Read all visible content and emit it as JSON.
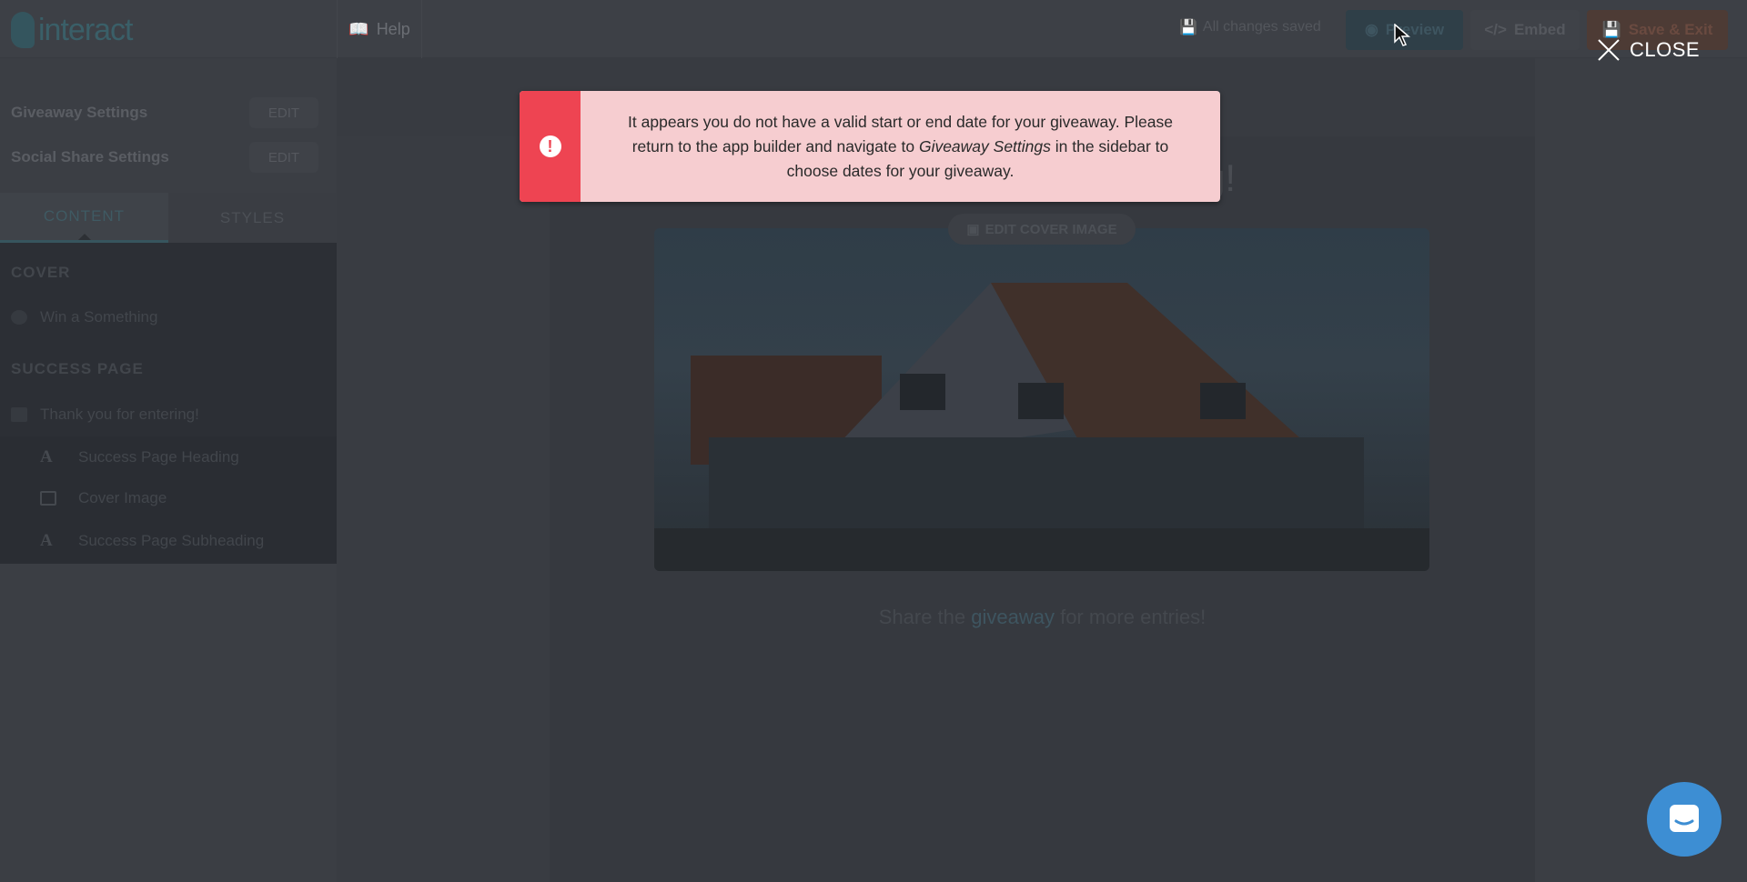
{
  "header": {
    "logo": "interact",
    "help": "Help",
    "saved_status": "All changes saved",
    "preview": "Preview",
    "embed": "Embed",
    "save_exit": "Save & Exit"
  },
  "sidebar": {
    "settings": [
      {
        "label": "Giveaway Settings",
        "action": "EDIT"
      },
      {
        "label": "Social Share Settings",
        "action": "EDIT"
      }
    ],
    "tabs": [
      {
        "label": "CONTENT",
        "active": true
      },
      {
        "label": "STYLES",
        "active": false
      }
    ],
    "sections": [
      {
        "title": "COVER",
        "items": [
          {
            "label": "Win a Something",
            "icon": "trophy-icon"
          }
        ]
      },
      {
        "title": "SUCCESS PAGE",
        "items": [
          {
            "label": "Thank you for entering!",
            "icon": "page-icon"
          }
        ],
        "subitems": [
          {
            "label": "Success Page Heading",
            "icon": "text-icon"
          },
          {
            "label": "Cover Image",
            "icon": "image-icon"
          },
          {
            "label": "Success Page Subheading",
            "icon": "text-icon"
          }
        ]
      }
    ]
  },
  "canvas": {
    "heading_tail": "g!",
    "edit_cover": "EDIT COVER IMAGE",
    "share_pre": "Share the ",
    "share_link": "giveaway",
    "share_post": " for more entries!"
  },
  "alert": {
    "line1": "It appears you do not have a valid start or end date for your giveaway. Please return to the app builder and navigate to ",
    "emph": "Giveaway Settings",
    "line2": " in the sidebar to choose dates for your giveaway.",
    "color": "#ee4452",
    "bg": "#f6cdd0"
  },
  "overlay": {
    "close": "CLOSE"
  }
}
